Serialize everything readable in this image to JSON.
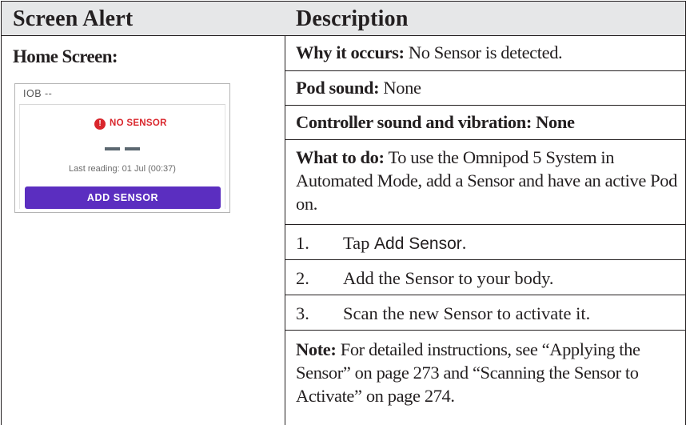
{
  "table": {
    "headers": [
      "Screen Alert",
      "Description"
    ],
    "left": {
      "home_screen_label": "Home Screen:"
    },
    "widget": {
      "iob_label": "IOB --",
      "alert_icon": "exclamation-circle-icon",
      "alert_text": "NO SENSOR",
      "last_reading": "Last reading: 01 Jul (00:37)",
      "button_label": "ADD SENSOR",
      "colors": {
        "alert": "#d9262c",
        "button": "#5b2ec0",
        "dash": "#5b6770"
      }
    },
    "rows": {
      "why": {
        "label": "Why it occurs:",
        "text": "No Sensor is detected."
      },
      "pod": {
        "label": "Pod sound:",
        "text": "None"
      },
      "controller": {
        "label": "Controller sound and vibration: None"
      },
      "what": {
        "label": "What to do:",
        "text": "To use the Omnipod 5 System in Automated Mode, add a Sensor and have an active Pod on."
      },
      "steps": [
        {
          "num": "1.",
          "pre": "Tap ",
          "action": "Add Sensor",
          "post": "."
        },
        {
          "num": "2.",
          "text": "Add the Sensor to your body."
        },
        {
          "num": "3.",
          "text": "Scan the new Sensor to activate it."
        }
      ],
      "note": {
        "label": "Note:",
        "text": "For detailed instructions, see “Applying the Sensor” on page 273 and “Scanning the Sensor to Activate” on page 274."
      }
    }
  }
}
